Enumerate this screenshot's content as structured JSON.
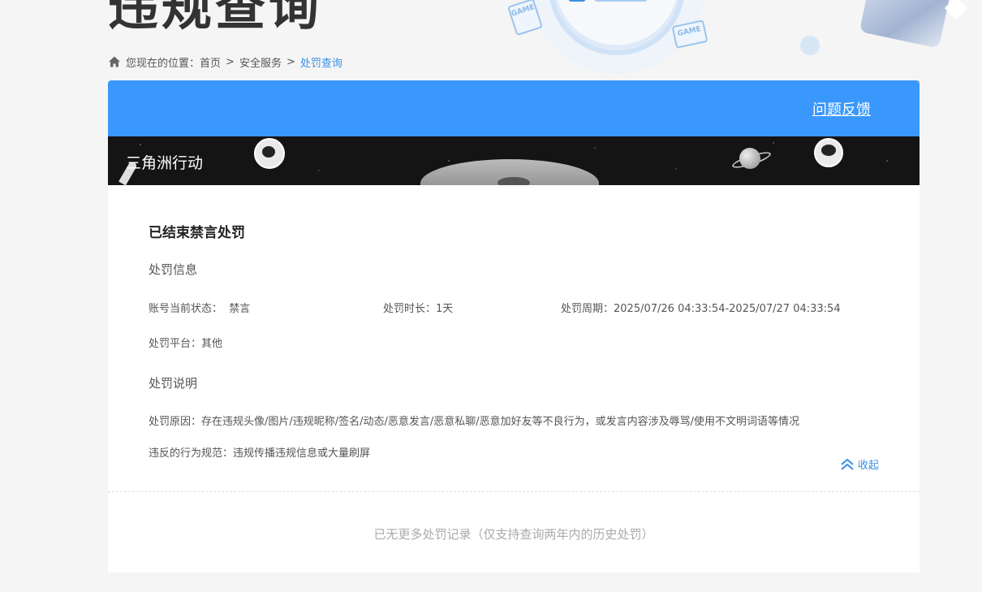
{
  "hero": {
    "title": "违规查询",
    "game_badge": "GAME"
  },
  "breadcrumb": {
    "prefix": "您现在的位置：",
    "items": [
      "首页",
      "安全服务",
      "处罚查询"
    ],
    "separator": ">"
  },
  "card": {
    "feedback_link": "问题反馈",
    "game_name": "三角洲行动",
    "record": {
      "title": "已结束禁言处罚",
      "info_heading": "处罚信息",
      "status_label": "账号当前状态：",
      "status_value": "禁言",
      "duration_label": "处罚时长：",
      "duration_value": "1天",
      "period_label": "处罚周期：",
      "period_value": "2025/07/26 04:33:54-2025/07/27 04:33:54",
      "platform_label": "处罚平台：",
      "platform_value": "其他",
      "desc_heading": "处罚说明",
      "reason_label": "处罚原因：",
      "reason_value": "存在违规头像/图片/违规昵称/签名/动态/恶意发言/恶意私聊/恶意加好友等不良行为，或发言内容涉及辱骂/使用不文明词语等情况",
      "rule_label": "违反的行为规范：",
      "rule_value": "违规传播违规信息或大量刷屏",
      "collapse_label": "收起"
    },
    "footer_note": "已无更多处罚记录（仅支持查询两年内的历史处罚）"
  },
  "colors": {
    "accent": "#3a97fb",
    "link": "#3a8ee6",
    "banner_bg": "#141414"
  },
  "icons": {
    "home": "home-icon",
    "collapse": "double-chevron-up-icon"
  }
}
